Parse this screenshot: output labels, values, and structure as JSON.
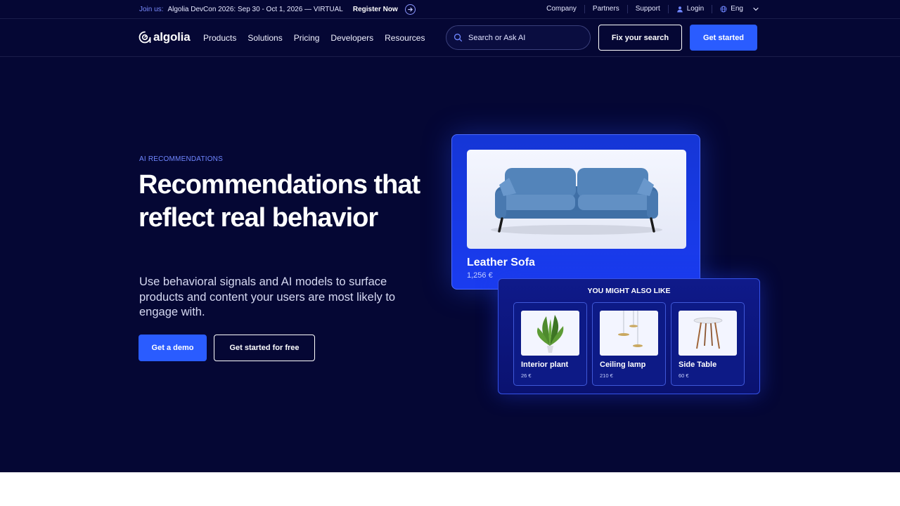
{
  "topbar": {
    "join_label": "Join us:",
    "event_text": "Algolia DevCon 2026: Sep 30 - Oct 1, 2026 — VIRTUAL",
    "register_label": "Register Now",
    "links": {
      "company": "Company",
      "partners": "Partners",
      "support": "Support",
      "login": "Login",
      "language": "Eng"
    }
  },
  "nav": {
    "logo_text": "algolia",
    "items": {
      "products": "Products",
      "solutions": "Solutions",
      "pricing": "Pricing",
      "developers": "Developers",
      "resources": "Resources"
    },
    "search_placeholder": "Search or Ask AI",
    "fix_search_label": "Fix your search",
    "get_started_label": "Get started"
  },
  "hero": {
    "eyebrow": "AI RECOMMENDATIONS",
    "headline": "Recommendations that reflect real behavior",
    "subtext": "Use behavioral signals and AI models to surface products and content your users are most likely to engage with.",
    "demo_label": "Get a demo",
    "free_label": "Get started for free"
  },
  "product_card": {
    "name": "Leather Sofa",
    "price": "1,256 €"
  },
  "recommendations": {
    "title": "YOU MIGHT ALSO LIKE",
    "items": [
      {
        "name": "Interior plant",
        "price": "26 €"
      },
      {
        "name": "Ceiling lamp",
        "price": "210 €"
      },
      {
        "name": "Side Table",
        "price": "60 €"
      }
    ]
  },
  "colors": {
    "background": "#050734",
    "accent": "#2a5cff",
    "eyebrow": "#6f86ff"
  }
}
